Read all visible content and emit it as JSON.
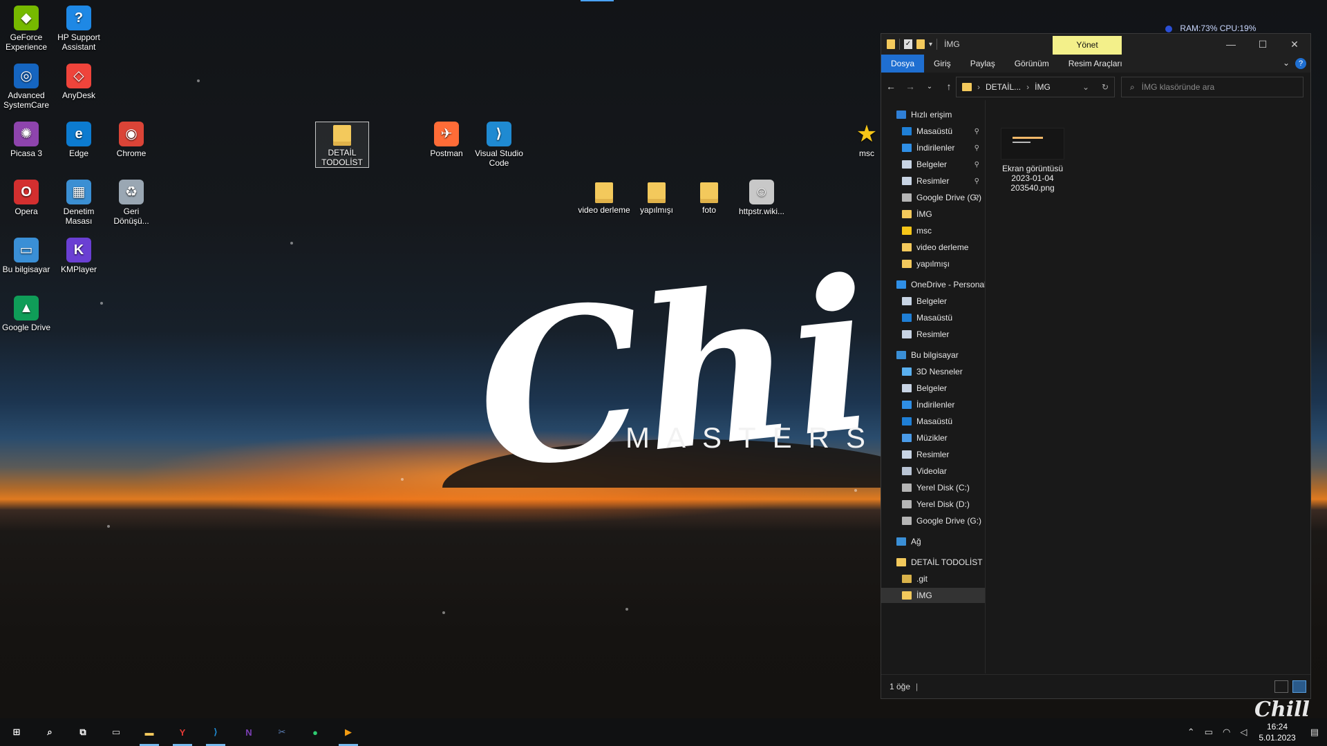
{
  "wallpaper": {
    "logo_text": "Chill",
    "logo_sub": "MASTERS",
    "watermark_text": "Chill"
  },
  "desktop_icons": [
    {
      "label": "GeForce Experience",
      "icon": "geforce-icon",
      "color": "#76b900",
      "glyph": "◆"
    },
    {
      "label": "HP Support Assistant",
      "icon": "help-icon",
      "color": "#1e88e5",
      "glyph": "?"
    },
    {
      "label": "Advanced SystemCare",
      "icon": "systemcare-icon",
      "color": "#1565c0",
      "glyph": "◎"
    },
    {
      "label": "AnyDesk",
      "icon": "anydesk-icon",
      "color": "#ef443b",
      "glyph": "◇"
    },
    {
      "label": "Picasa 3",
      "icon": "picasa-icon",
      "color": "#8e44ad",
      "glyph": "✺"
    },
    {
      "label": "Edge",
      "icon": "edge-icon",
      "color": "#0c7bd0",
      "glyph": "e"
    },
    {
      "label": "Chrome",
      "icon": "chrome-icon",
      "color": "#db4437",
      "glyph": "◉"
    },
    {
      "label": "Opera",
      "icon": "opera-icon",
      "color": "#d32f2f",
      "glyph": "O"
    },
    {
      "label": "Denetim Masası",
      "icon": "control-panel-icon",
      "color": "#3b8fd3",
      "glyph": "▦"
    },
    {
      "label": "Geri Dönüşü...",
      "icon": "recycle-bin-icon",
      "color": "#9aa7b3",
      "glyph": "♻"
    },
    {
      "label": "Bu bilgisayar",
      "icon": "computer-icon",
      "color": "#3a8fd6",
      "glyph": "▭"
    },
    {
      "label": "KMPlayer",
      "icon": "kmplayer-icon",
      "color": "#6a3fd3",
      "glyph": "K"
    },
    {
      "label": "Google Drive",
      "icon": "google-drive-icon",
      "color": "#0f9d58",
      "glyph": "▲"
    },
    {
      "label": "DETAİL TODOLİST",
      "icon": "folder-zip-icon",
      "color": "#f3c95c",
      "glyph": ""
    },
    {
      "label": "Postman",
      "icon": "postman-icon",
      "color": "#ff6c37",
      "glyph": "✈"
    },
    {
      "label": "Visual Studio Code",
      "icon": "vscode-icon",
      "color": "#1f8ad2",
      "glyph": "⟩"
    },
    {
      "label": "msc",
      "icon": "star-icon",
      "color": "#f5c518",
      "glyph": "★"
    },
    {
      "label": "video derleme",
      "icon": "folder-icon",
      "color": "#f3c95c",
      "glyph": ""
    },
    {
      "label": "yapılmışı",
      "icon": "folder-icon",
      "color": "#f3c95c",
      "glyph": ""
    },
    {
      "label": "foto",
      "icon": "folder-icon",
      "color": "#f3c95c",
      "glyph": ""
    },
    {
      "label": "httpstr.wiki...",
      "icon": "shortcut-icon",
      "color": "#c8c8c8",
      "glyph": "☺"
    }
  ],
  "explorer": {
    "window_title": "İMG",
    "manage_tab": "Yönet",
    "ribbon_tabs": [
      "Dosya",
      "Giriş",
      "Paylaş",
      "Görünüm",
      "Resim Araçları"
    ],
    "breadcrumb": [
      "DETAİL...",
      "İMG"
    ],
    "search_placeholder": "İMG klasöründe ara",
    "nav_items": [
      {
        "label": "Hızlı erişim",
        "color": "#2f7fd6",
        "indent": 0,
        "pinned": false
      },
      {
        "label": "Masaüstü",
        "color": "#1f7fd6",
        "indent": 1,
        "pinned": true
      },
      {
        "label": "İndirilenler",
        "color": "#2f8fe6",
        "indent": 1,
        "pinned": true
      },
      {
        "label": "Belgeler",
        "color": "#c8d4e4",
        "indent": 1,
        "pinned": true
      },
      {
        "label": "Resimler",
        "color": "#c8d4e4",
        "indent": 1,
        "pinned": true
      },
      {
        "label": "Google Drive (G:)",
        "color": "#b5b5b5",
        "indent": 1,
        "pinned": true
      },
      {
        "label": "İMG",
        "color": "#f3c95c",
        "indent": 1,
        "pinned": false
      },
      {
        "label": "msc",
        "color": "#f5c518",
        "indent": 1,
        "pinned": false
      },
      {
        "label": "video derleme",
        "color": "#f3c95c",
        "indent": 1,
        "pinned": false
      },
      {
        "label": "yapılmışı",
        "color": "#f3c95c",
        "indent": 1,
        "pinned": false
      },
      {
        "label": "OneDrive - Personal",
        "color": "#2f8fe6",
        "indent": 0,
        "pinned": false
      },
      {
        "label": "Belgeler",
        "color": "#c8d4e4",
        "indent": 1,
        "pinned": false
      },
      {
        "label": "Masaüstü",
        "color": "#1f7fd6",
        "indent": 1,
        "pinned": false
      },
      {
        "label": "Resimler",
        "color": "#c8d4e4",
        "indent": 1,
        "pinned": false
      },
      {
        "label": "Bu bilgisayar",
        "color": "#3a8fd6",
        "indent": 0,
        "pinned": false
      },
      {
        "label": "3D Nesneler",
        "color": "#5ab0f0",
        "indent": 1,
        "pinned": false
      },
      {
        "label": "Belgeler",
        "color": "#c8d4e4",
        "indent": 1,
        "pinned": false
      },
      {
        "label": "İndirilenler",
        "color": "#2f8fe6",
        "indent": 1,
        "pinned": false
      },
      {
        "label": "Masaüstü",
        "color": "#1f7fd6",
        "indent": 1,
        "pinned": false
      },
      {
        "label": "Müzikler",
        "color": "#4a9be8",
        "indent": 1,
        "pinned": false
      },
      {
        "label": "Resimler",
        "color": "#c8d4e4",
        "indent": 1,
        "pinned": false
      },
      {
        "label": "Videolar",
        "color": "#b9c4d4",
        "indent": 1,
        "pinned": false
      },
      {
        "label": "Yerel Disk (C:)",
        "color": "#b5b5b5",
        "indent": 1,
        "pinned": false
      },
      {
        "label": "Yerel Disk (D:)",
        "color": "#b5b5b5",
        "indent": 1,
        "pinned": false
      },
      {
        "label": "Google Drive (G:)",
        "color": "#b5b5b5",
        "indent": 1,
        "pinned": false
      },
      {
        "label": "Ağ",
        "color": "#3a8fd6",
        "indent": 0,
        "pinned": false
      },
      {
        "label": "DETAİL TODOLİST",
        "color": "#f3c95c",
        "indent": 0,
        "pinned": false
      },
      {
        "label": ".git",
        "color": "#d9b24a",
        "indent": 1,
        "pinned": false
      },
      {
        "label": "İMG",
        "color": "#f3c95c",
        "indent": 1,
        "pinned": false,
        "selected": true
      }
    ],
    "file": {
      "name": "Ekran görüntüsü 2023-01-04 203540.png"
    },
    "status_count": "1 öğe"
  },
  "sysmon": {
    "text": "RAM:73%  CPU:19%"
  },
  "taskbar": {
    "items": [
      {
        "name": "start-button",
        "icon": "windows-icon",
        "glyph": "⊞",
        "color": "#ffffff",
        "active": false
      },
      {
        "name": "search-button",
        "icon": "search-icon",
        "glyph": "⌕",
        "color": "#ffffff",
        "active": false
      },
      {
        "name": "task-view-button",
        "icon": "task-view-icon",
        "glyph": "⧉",
        "color": "#ffffff",
        "active": false
      },
      {
        "name": "terminal-button",
        "icon": "terminal-icon",
        "glyph": "▭",
        "color": "#dddddd",
        "active": false
      },
      {
        "name": "file-explorer-button",
        "icon": "folder-icon",
        "glyph": "▬",
        "color": "#f3c95c",
        "active": true
      },
      {
        "name": "yandex-button",
        "icon": "yandex-icon",
        "glyph": "Y",
        "color": "#e53935",
        "active": true
      },
      {
        "name": "vscode-button",
        "icon": "vscode-icon",
        "glyph": "⟩",
        "color": "#1f8ad2",
        "active": true
      },
      {
        "name": "onenote-button",
        "icon": "onenote-icon",
        "glyph": "N",
        "color": "#7b3fb5",
        "active": false
      },
      {
        "name": "snipping-tool-button",
        "icon": "snipping-icon",
        "glyph": "✂",
        "color": "#5b7fb5",
        "active": false
      },
      {
        "name": "app-button",
        "icon": "green-dot-icon",
        "glyph": "●",
        "color": "#2ecc71",
        "active": false
      },
      {
        "name": "player-button",
        "icon": "player-icon",
        "glyph": "▶",
        "color": "#f39c12",
        "active": true
      }
    ],
    "time": "16:24",
    "date": "5.01.2023"
  }
}
